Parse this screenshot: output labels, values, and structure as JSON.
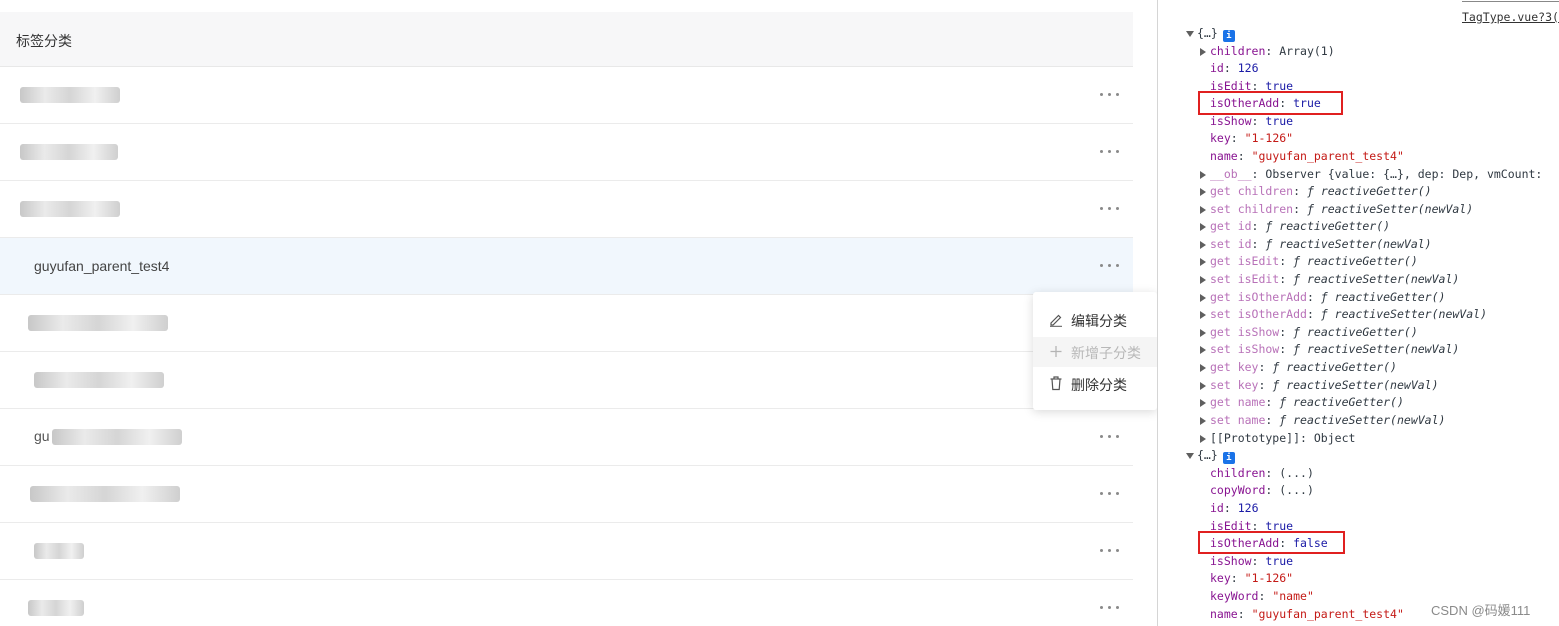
{
  "left_panel": {
    "title": "标签分类",
    "rows": [
      {
        "name": "",
        "blurred": true,
        "prefix": ""
      },
      {
        "name": "",
        "blurred": true,
        "prefix": ""
      },
      {
        "name": "",
        "blurred": true,
        "prefix": ""
      },
      {
        "name": "guyufan_parent_test4",
        "blurred": false,
        "prefix": "",
        "active": true
      },
      {
        "name": "",
        "blurred": true,
        "prefix": ""
      },
      {
        "name": "",
        "blurred": true,
        "prefix": ""
      },
      {
        "name": "",
        "blurred": true,
        "prefix": "gu"
      },
      {
        "name": "",
        "blurred": true,
        "prefix": ""
      },
      {
        "name": "",
        "blurred": true,
        "prefix": ""
      },
      {
        "name": "",
        "blurred": true,
        "prefix": ""
      }
    ],
    "context_menu": {
      "edit": "编辑分类",
      "add_child": "新增子分类",
      "delete": "删除分类"
    }
  },
  "devtools": {
    "source_link": "TagType.vue?3(",
    "obj1": {
      "header": "{…}",
      "children": {
        "key": "children",
        "value": "Array(1)"
      },
      "id": {
        "key": "id",
        "value": "126"
      },
      "isEdit": {
        "key": "isEdit",
        "value": "true"
      },
      "isOtherAdd": {
        "key": "isOtherAdd",
        "value": "true"
      },
      "isShow": {
        "key": "isShow",
        "value": "true"
      },
      "keyField": {
        "key": "key",
        "value": "\"1-126\""
      },
      "name": {
        "key": "name",
        "value": "\"guyufan_parent_test4\""
      },
      "ob": {
        "key": "__ob__",
        "value": "Observer {value: {…}, dep: Dep, vmCount:"
      },
      "accessors": [
        {
          "key": "get children",
          "value": "reactiveGetter()"
        },
        {
          "key": "set children",
          "value": "reactiveSetter(newVal)"
        },
        {
          "key": "get id",
          "value": "reactiveGetter()"
        },
        {
          "key": "set id",
          "value": "reactiveSetter(newVal)"
        },
        {
          "key": "get isEdit",
          "value": "reactiveGetter()"
        },
        {
          "key": "set isEdit",
          "value": "reactiveSetter(newVal)"
        },
        {
          "key": "get isOtherAdd",
          "value": "reactiveGetter()"
        },
        {
          "key": "set isOtherAdd",
          "value": "reactiveSetter(newVal)"
        },
        {
          "key": "get isShow",
          "value": "reactiveGetter()"
        },
        {
          "key": "set isShow",
          "value": "reactiveSetter(newVal)"
        },
        {
          "key": "get key",
          "value": "reactiveGetter()"
        },
        {
          "key": "set key",
          "value": "reactiveSetter(newVal)"
        },
        {
          "key": "get name",
          "value": "reactiveGetter()"
        },
        {
          "key": "set name",
          "value": "reactiveSetter(newVal)"
        }
      ],
      "prototype": {
        "key": "[[Prototype]]",
        "value": "Object"
      }
    },
    "obj2": {
      "header": "{…}",
      "children": {
        "key": "children",
        "value": "(...)"
      },
      "copyWord": {
        "key": "copyWord",
        "value": "(...)"
      },
      "id": {
        "key": "id",
        "value": "126"
      },
      "isEdit": {
        "key": "isEdit",
        "value": "true"
      },
      "isOtherAdd": {
        "key": "isOtherAdd",
        "value": "false"
      },
      "isShow": {
        "key": "isShow",
        "value": "true"
      },
      "keyField": {
        "key": "key",
        "value": "\"1-126\""
      },
      "keyWord": {
        "key": "keyWord",
        "value": "\"name\""
      },
      "name": {
        "key": "name",
        "value": "\"guyufan_parent_test4\""
      }
    },
    "func_symbol": "ƒ",
    "info_badge": "i"
  },
  "watermark": "CSDN @码媛111",
  "colors": {
    "highlight_box": "#e02020",
    "active_row": "#f1f7fd",
    "key_purple": "#881391",
    "string_red": "#c41a16",
    "number_blue": "#1a1aa6"
  }
}
